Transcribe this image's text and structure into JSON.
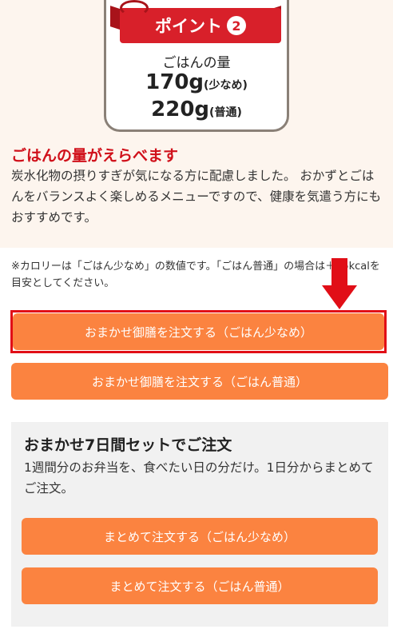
{
  "point": {
    "label": "ポイント",
    "number": "2",
    "rice_heading": "ごはんの量",
    "amount_small": "170g",
    "amount_small_note": "(少なめ)",
    "amount_normal": "220g",
    "amount_normal_note": "(普通)"
  },
  "section": {
    "heading": "ごはんの量がえらべます",
    "description": "炭水化物の摂りすぎが気になる方に配慮しました。 おかずとごはんをバランスよく楽しめるメニューですので、健康を気遣う方にもおすすめです。"
  },
  "note": "※カロリーは「ごはん少なめ」の数値です。「ごはん普通」の場合は＋85kcalを目安としてください。",
  "buttons": {
    "order_small": "おまかせ御膳を注文する（ごはん少なめ）",
    "order_normal": "おまかせ御膳を注文する（ごはん普通）"
  },
  "weekly_set": {
    "title": "おまかせ7日間セットでご注文",
    "description": "1週間分のお弁当を、食べたい日の分だけ。1日分からまとめてご注文。",
    "order_small": "まとめて注文する（ごはん少なめ）",
    "order_normal": "まとめて注文する（ごはん普通）"
  },
  "colors": {
    "accent_red": "#d0101a",
    "button_orange": "#fb8340",
    "highlight_red": "#e10e17",
    "top_background": "#fdf5ee"
  },
  "icons": {
    "annotation_arrow": "down-arrow-icon"
  }
}
